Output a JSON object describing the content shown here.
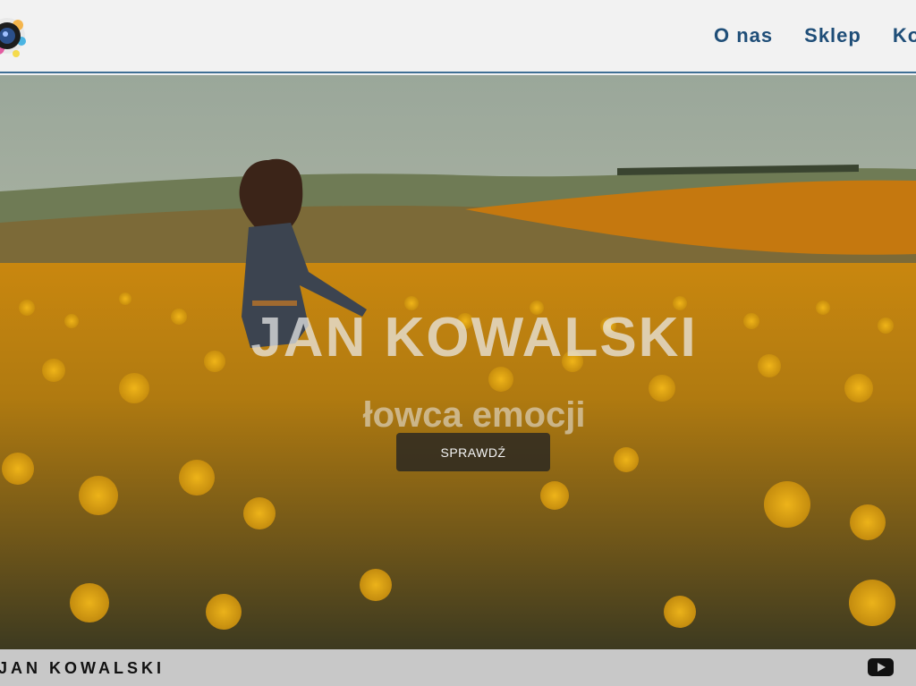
{
  "header": {
    "logo_icon": "camera-lens-logo-icon",
    "nav": [
      {
        "label": "O nas"
      },
      {
        "label": "Sklep"
      },
      {
        "label": "Ko"
      }
    ],
    "accent_color": "#1f4e78"
  },
  "hero": {
    "title": "JAN KOWALSKI",
    "subtitle": "łowca emocji",
    "cta_label": "SPRAWDŹ"
  },
  "footer": {
    "brand": "JAN KOWALSKI",
    "social_icon": "youtube-icon"
  }
}
